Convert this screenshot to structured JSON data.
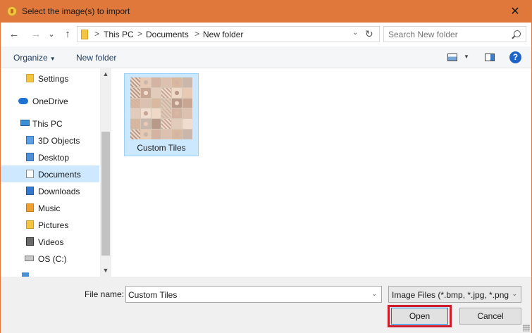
{
  "window": {
    "title": "Select the image(s) to import",
    "close_glyph": "✕"
  },
  "nav": {
    "back_glyph": "←",
    "forward_glyph": "→",
    "recent_glyph": "⌄",
    "up_glyph": "↑"
  },
  "address": {
    "crumbs": [
      "This PC",
      "Documents",
      "New folder"
    ],
    "separator": ">",
    "dropdown_glyph": "⌄",
    "refresh_glyph": "↻"
  },
  "search": {
    "placeholder": "Search New folder"
  },
  "toolbar": {
    "organize_label": "Organize",
    "organize_caret": "▼",
    "new_folder_label": "New folder",
    "view_caret": "▼",
    "help_label": "?"
  },
  "sidebar": {
    "items": [
      {
        "label": "Settings",
        "icon": "folder-icon"
      },
      {
        "label": "OneDrive",
        "icon": "cloud-icon"
      },
      {
        "label": "This PC",
        "icon": "computer-icon"
      },
      {
        "label": "3D Objects",
        "icon": "3d-objects-icon"
      },
      {
        "label": "Desktop",
        "icon": "desktop-icon"
      },
      {
        "label": "Documents",
        "icon": "documents-icon",
        "selected": true
      },
      {
        "label": "Downloads",
        "icon": "downloads-icon"
      },
      {
        "label": "Music",
        "icon": "music-icon"
      },
      {
        "label": "Pictures",
        "icon": "pictures-icon"
      },
      {
        "label": "Videos",
        "icon": "videos-icon"
      },
      {
        "label": "OS (C:)",
        "icon": "drive-icon"
      }
    ],
    "scroll_up_glyph": "▲",
    "scroll_down_glyph": "▼"
  },
  "files": [
    {
      "name": "Custom Tiles",
      "type": "folder",
      "selected": true
    }
  ],
  "footer": {
    "file_name_label": "File name:",
    "file_name_value": "Custom Tiles",
    "file_name_dd_glyph": "⌄",
    "filter_value": "Image Files (*.bmp, *.jpg, *.png)",
    "filter_dd_glyph": "⌄",
    "open_label": "Open",
    "cancel_label": "Cancel"
  },
  "colors": {
    "title_bar": "#e0783c",
    "selection": "#cde8ff",
    "highlight_box": "#d01c2a"
  }
}
